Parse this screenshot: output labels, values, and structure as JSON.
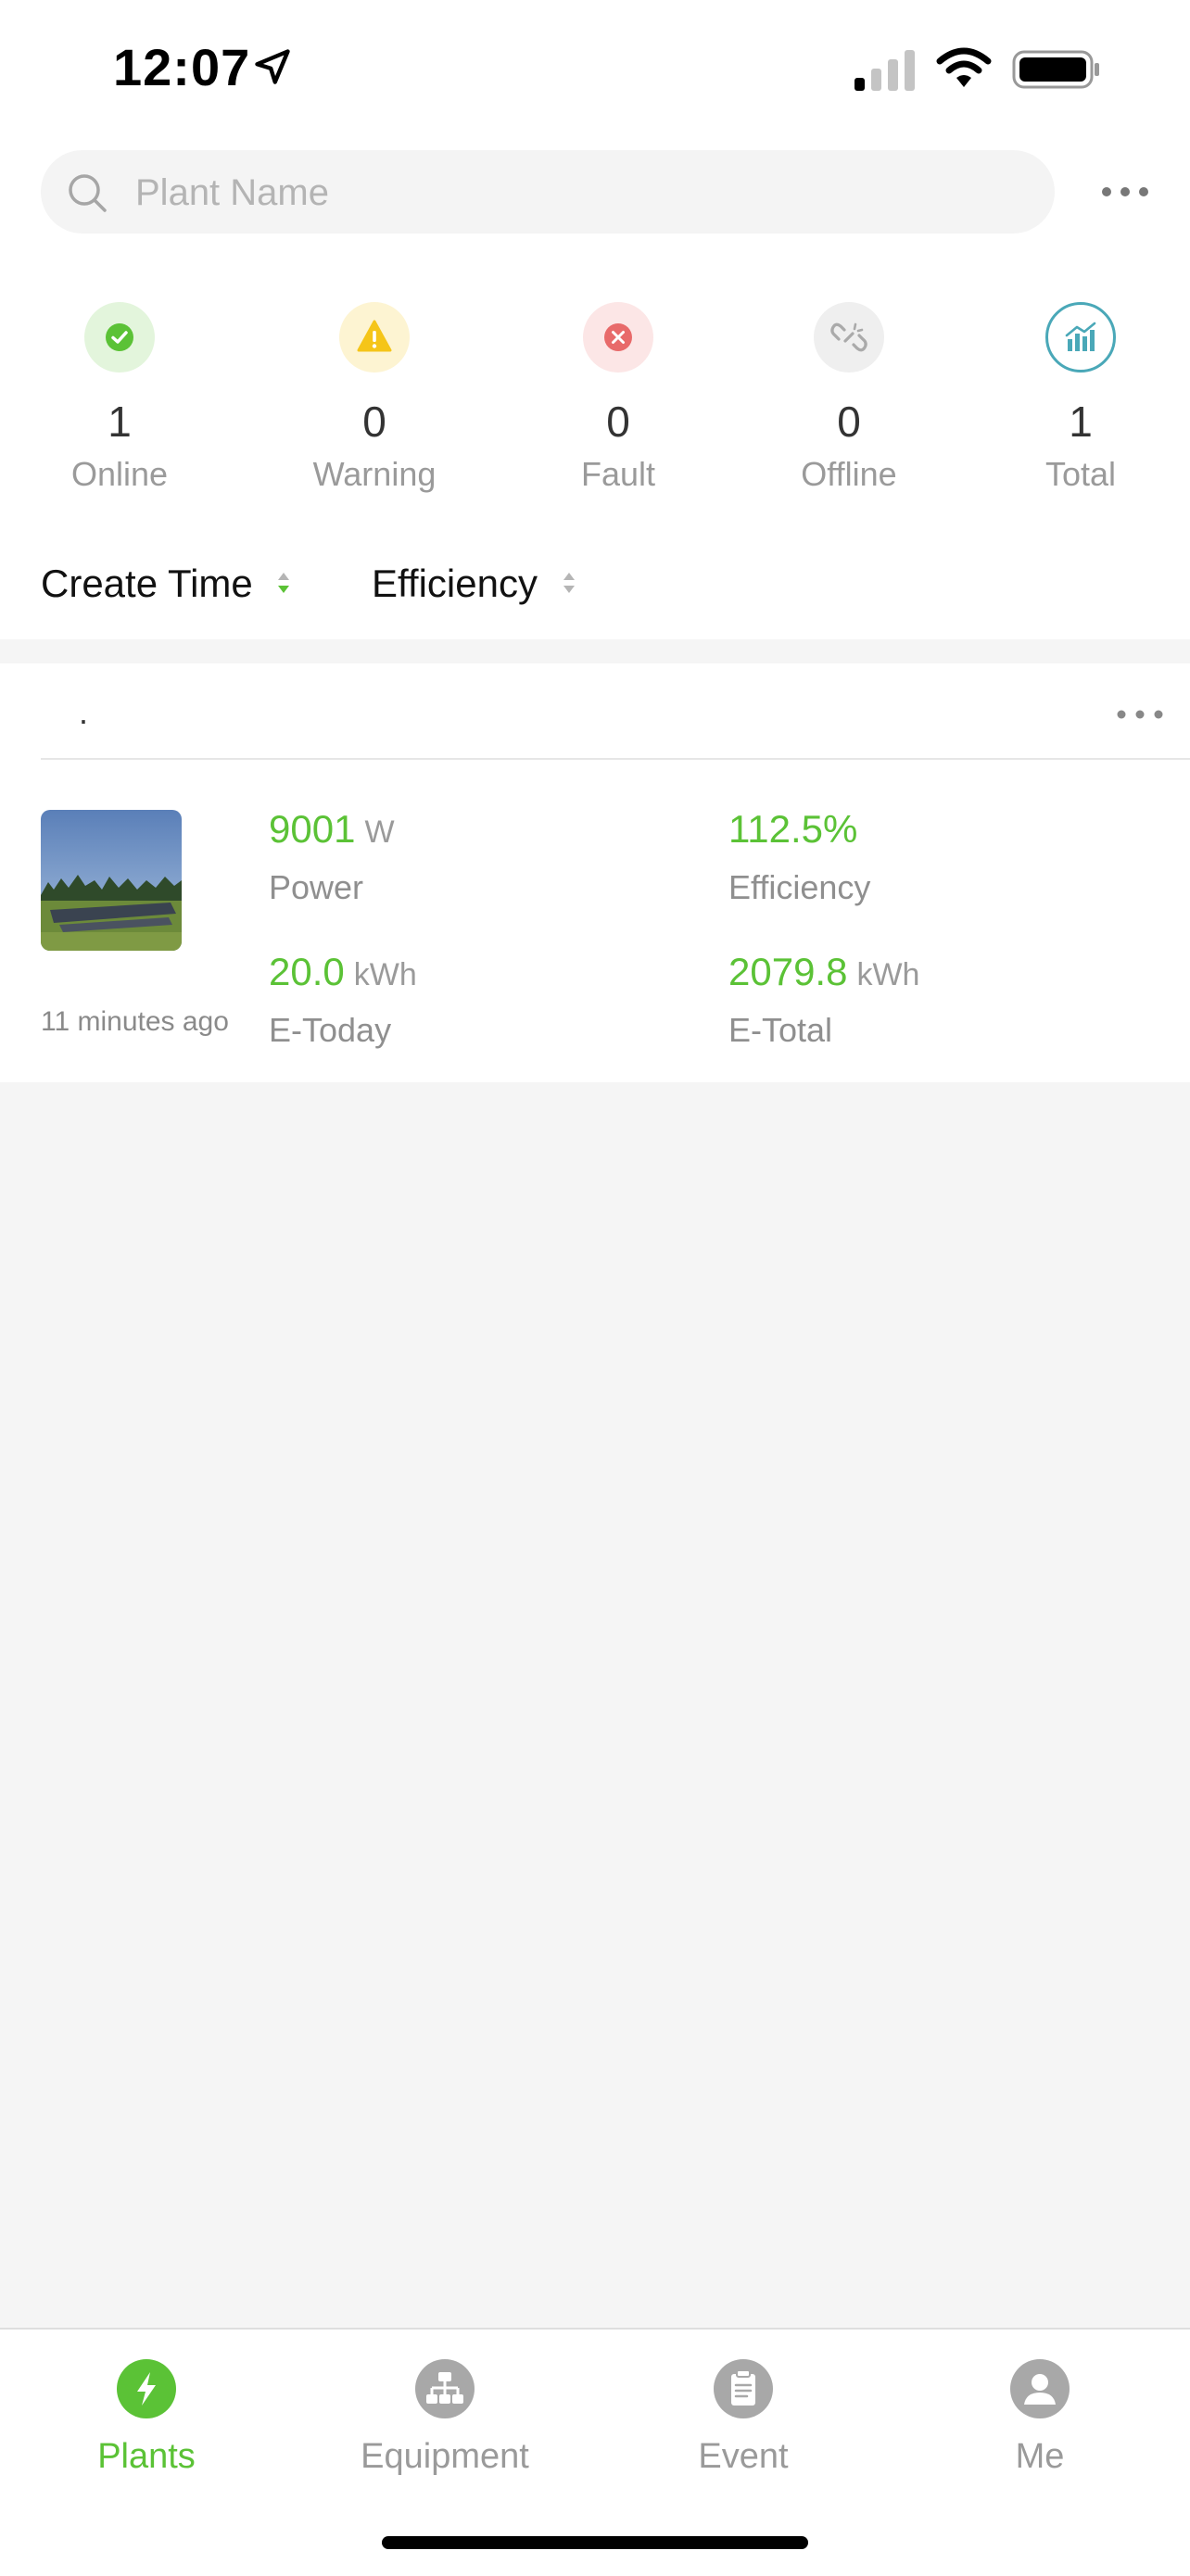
{
  "status_bar": {
    "time": "12:07"
  },
  "search": {
    "placeholder": "Plant Name"
  },
  "stats": [
    {
      "name": "online",
      "count": "1",
      "label": "Online",
      "icon": "check-circle-icon",
      "color": "#5bc236"
    },
    {
      "name": "warning",
      "count": "0",
      "label": "Warning",
      "icon": "warning-triangle-icon",
      "color": "#f5c518"
    },
    {
      "name": "fault",
      "count": "0",
      "label": "Fault",
      "icon": "x-circle-icon",
      "color": "#e86a6a"
    },
    {
      "name": "offline",
      "count": "0",
      "label": "Offline",
      "icon": "broken-link-icon",
      "color": "#b0b0b0"
    },
    {
      "name": "total",
      "count": "1",
      "label": "Total",
      "icon": "bar-chart-icon",
      "color": "#4aa8b8"
    }
  ],
  "sort": {
    "create_time": "Create Time",
    "efficiency": "Efficiency"
  },
  "plant_card": {
    "name": "·",
    "updated": "11 minutes ago",
    "power": {
      "value": "9001",
      "unit": "W",
      "label": "Power"
    },
    "efficiency": {
      "value": "112.5%",
      "unit": "",
      "label": "Efficiency"
    },
    "e_today": {
      "value": "20.0",
      "unit": "kWh",
      "label": "E-Today"
    },
    "e_total": {
      "value": "2079.8",
      "unit": "kWh",
      "label": "E-Total"
    }
  },
  "tabs": [
    {
      "label": "Plants",
      "icon": "lightning-icon",
      "active": true
    },
    {
      "label": "Equipment",
      "icon": "network-icon",
      "active": false
    },
    {
      "label": "Event",
      "icon": "clipboard-icon",
      "active": false
    },
    {
      "label": "Me",
      "icon": "user-icon",
      "active": false
    }
  ],
  "colors": {
    "accent": "#5bc236",
    "inactive": "#9a9a9a",
    "background": "#f5f5f5"
  }
}
